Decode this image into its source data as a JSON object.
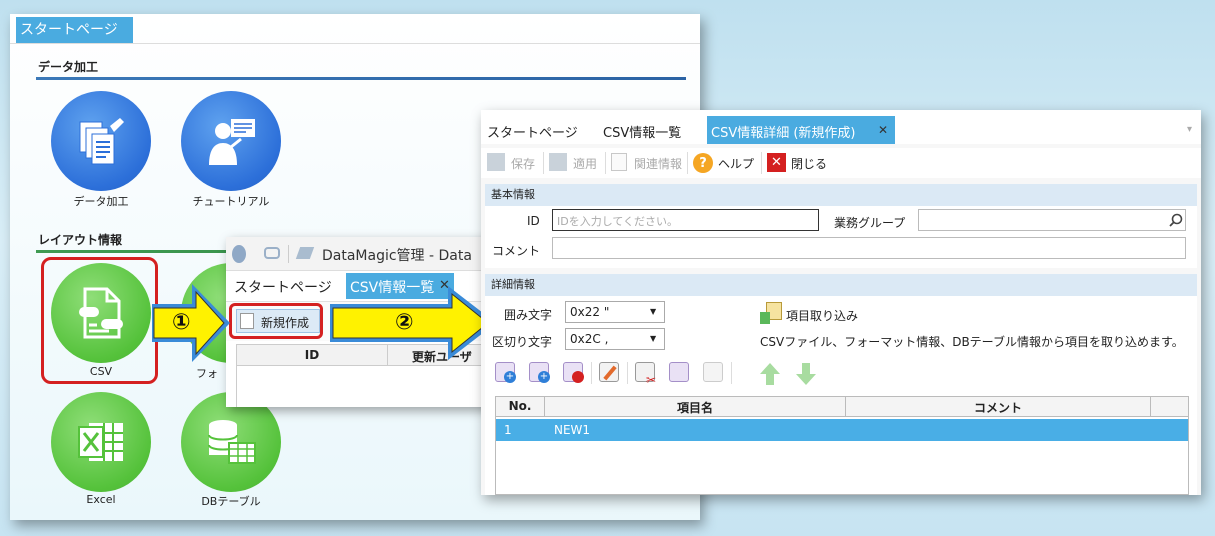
{
  "startpage": {
    "tab": "スタートページ",
    "section1": "データ加工",
    "section2": "レイアウト情報",
    "items1": [
      {
        "label": "データ加工",
        "icon": "data-processing-icon"
      },
      {
        "label": "チュートリアル",
        "icon": "tutorial-icon"
      }
    ],
    "items2": [
      {
        "label": "CSV",
        "icon": "csv-file-icon"
      },
      {
        "label": "フォ",
        "icon": "format-icon"
      },
      {
        "label": "Excel",
        "icon": "excel-icon"
      },
      {
        "label": "DBテーブル",
        "icon": "db-table-icon"
      }
    ]
  },
  "list_window": {
    "title": "DataMagic管理 - Data",
    "tabs": [
      "スタートページ",
      "CSV情報一覧"
    ],
    "new_button": "新規作成",
    "columns": [
      "ID",
      "更新ユーザ"
    ]
  },
  "annotations": {
    "step1": "①",
    "step2": "②"
  },
  "detail_window": {
    "tabs": [
      "スタートページ",
      "CSV情報一覧",
      "CSV情報詳細 (新規作成)"
    ],
    "toolbar": {
      "save": "保存",
      "apply": "適用",
      "related": "関連情報",
      "help": "ヘルプ",
      "close": "閉じる"
    },
    "basic_header": "基本情報",
    "id_label": "ID",
    "id_placeholder": "IDを入力してください。",
    "group_label": "業務グループ",
    "comment_label": "コメント",
    "detail_header": "詳細情報",
    "enclose_label": "囲み文字",
    "enclose_value": "0x22 \"",
    "delimiter_label": "区切り文字",
    "delimiter_value": "0x2C ,",
    "import_button": "項目取り込み",
    "import_desc": "CSVファイル、フォーマット情報、DBテーブル情報から項目を取り込めます。",
    "grid": {
      "columns": [
        "No.",
        "項目名",
        "コメント"
      ],
      "rows": [
        {
          "no": "1",
          "name": "NEW1",
          "comment": ""
        }
      ]
    }
  },
  "colors": {
    "accent": "#4aabe0",
    "highlight_red": "#d42020",
    "arrow_yellow": "#fff200",
    "selected_row": "#49aee6"
  }
}
